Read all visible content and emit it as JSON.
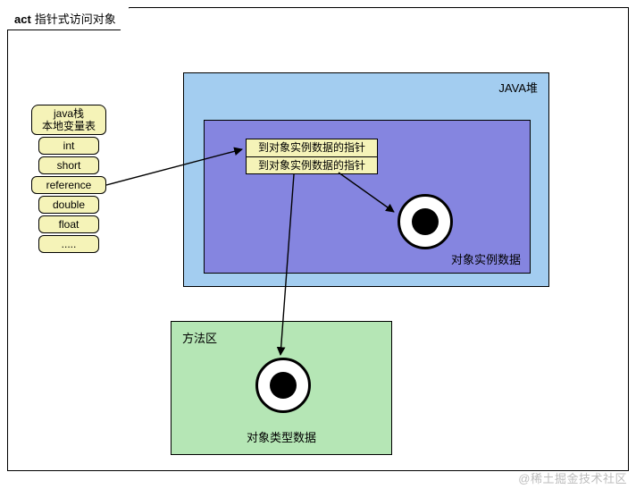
{
  "title_prefix": "act",
  "title": "指针式访问对象",
  "stack": {
    "header_line1": "java栈",
    "header_line2": "本地变量表",
    "items": [
      "int",
      "short",
      "reference",
      "double",
      "float",
      "....."
    ]
  },
  "heap": {
    "label": "JAVA堆",
    "inner_label": "对象实例数据",
    "pointer_rows": [
      "到对象实例数据的指针",
      "到对象实例数据的指针"
    ]
  },
  "method_area": {
    "label": "方法区",
    "caption": "对象类型数据"
  },
  "watermark": "@稀土掘金技术社区"
}
